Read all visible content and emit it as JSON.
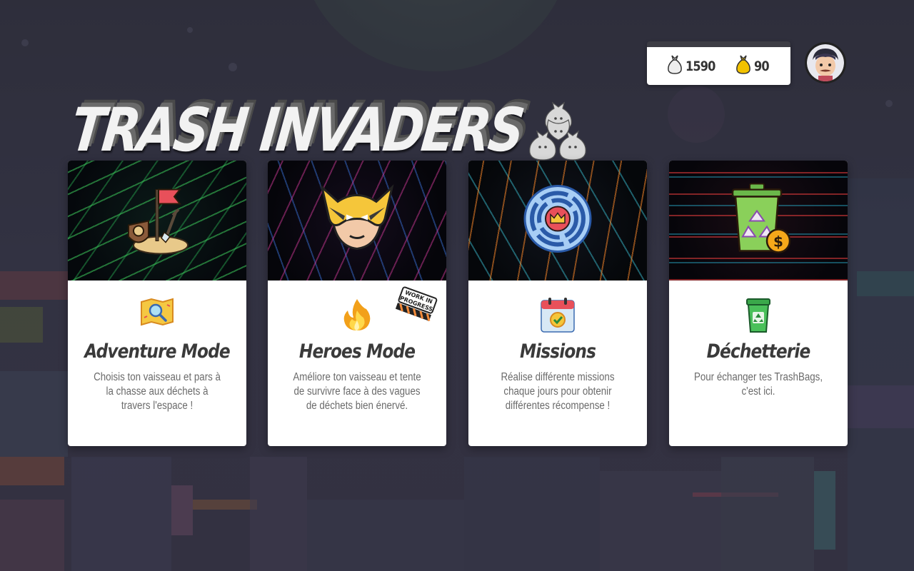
{
  "hud": {
    "trashbags": "1590",
    "gold": "90",
    "trashbag_icon": "trash-bag-icon",
    "gold_icon": "gold-bag-icon"
  },
  "title": "TRASH INVADERS",
  "cards": [
    {
      "title": "Adventure Mode",
      "description": "Choisis ton vaisseau et pars à la chasse aux déchets à travers l'espace !",
      "banner_icon": "treasure-island-icon",
      "body_icon": "treasure-map-icon"
    },
    {
      "title": "Heroes Mode",
      "description": "Améliore ton vaisseau et tente de survivre face à des vagues de déchets bien énervé.",
      "banner_icon": "hero-mask-icon",
      "body_icon": "fire-icon",
      "badge": "WORK IN PROGRESS"
    },
    {
      "title": "Missions",
      "description": "Réalise différente missions chaque jours pour obtenir différentes récompense !",
      "banner_icon": "target-crown-icon",
      "body_icon": "calendar-check-icon"
    },
    {
      "title": "Déchetterie",
      "description": "Pour échanger tes TrashBags, c'est ici.",
      "banner_icon": "recycle-bin-dollar-icon",
      "body_icon": "recycle-bin-icon"
    }
  ],
  "colors": {
    "card_bg": "#ffffff",
    "text_dark": "#3a3a3a",
    "text_muted": "#6a6a6a",
    "gold": "#f2c200"
  }
}
